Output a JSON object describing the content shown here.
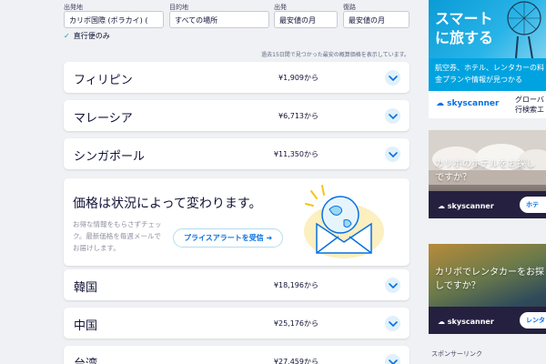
{
  "search": {
    "origin_label": "出発地",
    "origin_value": "カリボ国際 (ボラカイ) (",
    "destination_label": "目的地",
    "destination_value": "すべての場所",
    "depart_label": "出発",
    "depart_value": "最安値の月",
    "return_label": "復路",
    "return_value": "最安値の月",
    "direct_only_label": "直行便のみ",
    "direct_only_checked": true
  },
  "note": "過去15日間で見つかった最安の概算価格を表示しています。",
  "results": [
    {
      "country": "フィリピン",
      "price": "¥1,909から"
    },
    {
      "country": "マレーシア",
      "price": "¥6,713から"
    },
    {
      "country": "シンガポール",
      "price": "¥11,350から"
    },
    {
      "country": "韓国",
      "price": "¥18,196から"
    },
    {
      "country": "中国",
      "price": "¥25,176から"
    },
    {
      "country": "台湾",
      "price": "¥27,459から"
    }
  ],
  "price_alert": {
    "title": "価格は状況によって変わります。",
    "body": "お得な情報をもらさずチェック。最新価格を毎週メールでお届けします。",
    "button_label": "プライスアラートを受信 ➜"
  },
  "sponsor_label": "スポンサーリンク",
  "ads": {
    "ad1": {
      "headline": "スマート\nに旅する",
      "band_text": "航空券、ホテル、レンタカーの料\n金プランや情報が見つかる",
      "logo": "skyscanner",
      "sub_text": "グローバ\n行検索エ"
    },
    "ad2": {
      "text": "カリボのホテルをお探し\nですか？",
      "logo": "skyscanner",
      "button": "ホテ"
    },
    "ad3": {
      "text": "カリボでレンタカーをお探\nしですか？",
      "logo": "skyscanner",
      "button": "レンタ"
    }
  },
  "colors": {
    "accent": "#0770e3",
    "background": "#eff1f4",
    "chevron_bg": "#e0f1fb",
    "check": "#00a698"
  }
}
